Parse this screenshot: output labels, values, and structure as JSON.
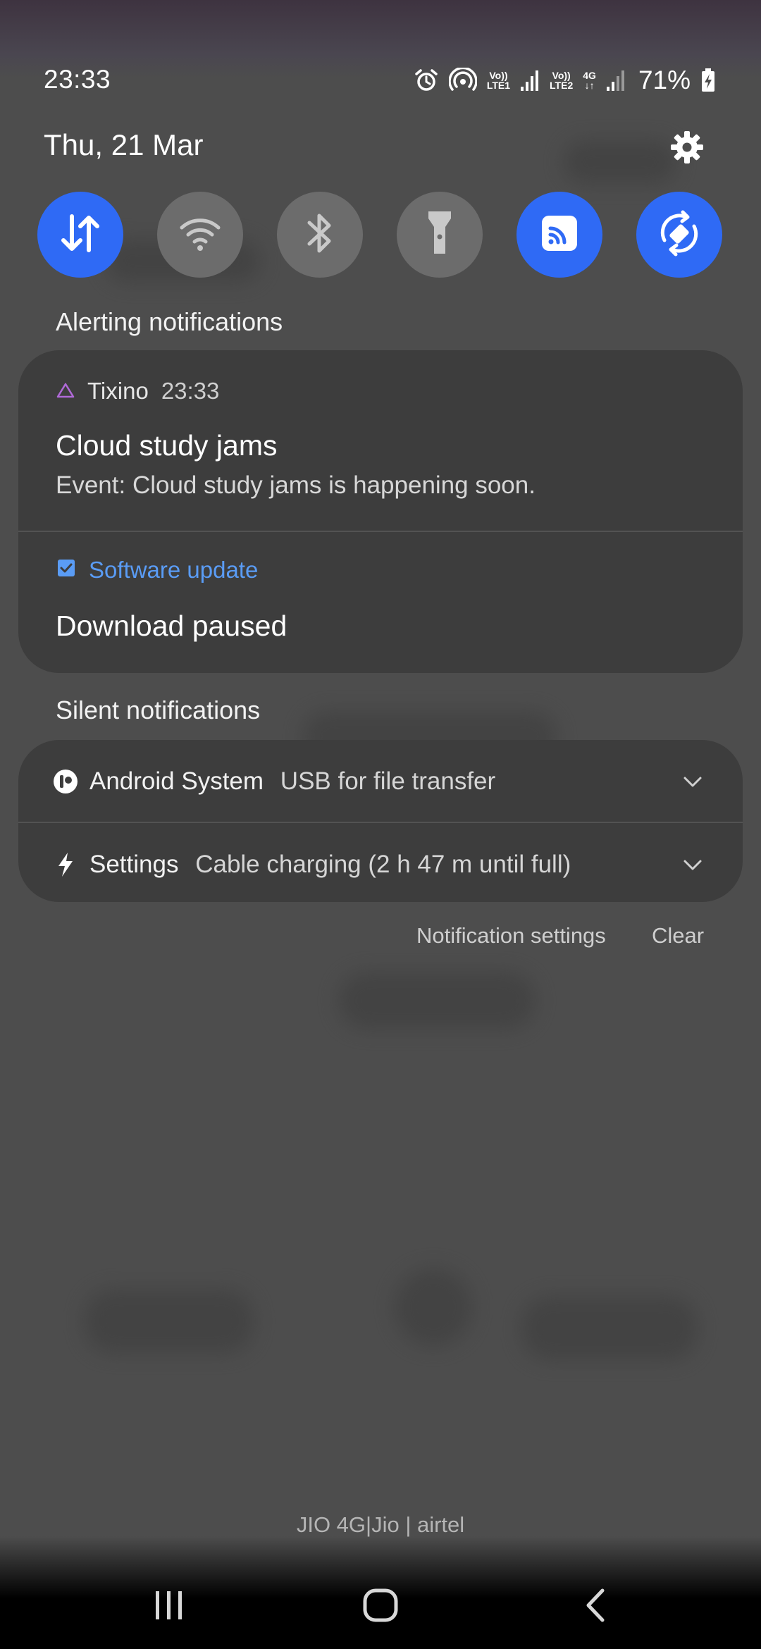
{
  "status_bar": {
    "time": "23:33",
    "sim1_volte": "Vo))",
    "sim1_lte": "LTE1",
    "sim2_volte": "Vo))",
    "sim2_lte": "LTE2",
    "network_type": "4G",
    "battery_percent": "71%",
    "icons": [
      "alarm-icon",
      "hotspot-icon",
      "signal-icon",
      "signal-icon",
      "battery-charging-icon"
    ]
  },
  "header": {
    "date": "Thu, 21 Mar"
  },
  "quick_settings": [
    {
      "name": "mobile-data",
      "icon": "data-arrows-icon",
      "state": "on"
    },
    {
      "name": "wifi",
      "icon": "wifi-icon",
      "state": "off"
    },
    {
      "name": "bluetooth",
      "icon": "bluetooth-icon",
      "state": "off"
    },
    {
      "name": "flashlight",
      "icon": "flashlight-icon",
      "state": "off"
    },
    {
      "name": "cast",
      "icon": "cast-icon",
      "state": "on"
    },
    {
      "name": "auto-rotate",
      "icon": "auto-rotate-icon",
      "state": "on"
    }
  ],
  "alerting": {
    "section_label": "Alerting notifications",
    "notifications": [
      {
        "app": "Tixino",
        "time": "23:33",
        "title": "Cloud study jams",
        "text": "Event: Cloud study jams is happening soon."
      },
      {
        "app": "Software update",
        "title": "Download paused"
      }
    ]
  },
  "silent": {
    "section_label": "Silent notifications",
    "notifications": [
      {
        "app": "Android System",
        "text": "USB for file transfer"
      },
      {
        "app": "Settings",
        "text": "Cable charging (2 h 47 m until full)"
      }
    ]
  },
  "actions": {
    "notification_settings": "Notification settings",
    "clear": "Clear"
  },
  "carrier_text": "JIO 4G|Jio | airtel",
  "colors": {
    "accent": "#2f6af5",
    "link_blue": "#5a9cf5",
    "tile_off": "#6c6c6c",
    "card_bg": "#3d3d3d"
  }
}
